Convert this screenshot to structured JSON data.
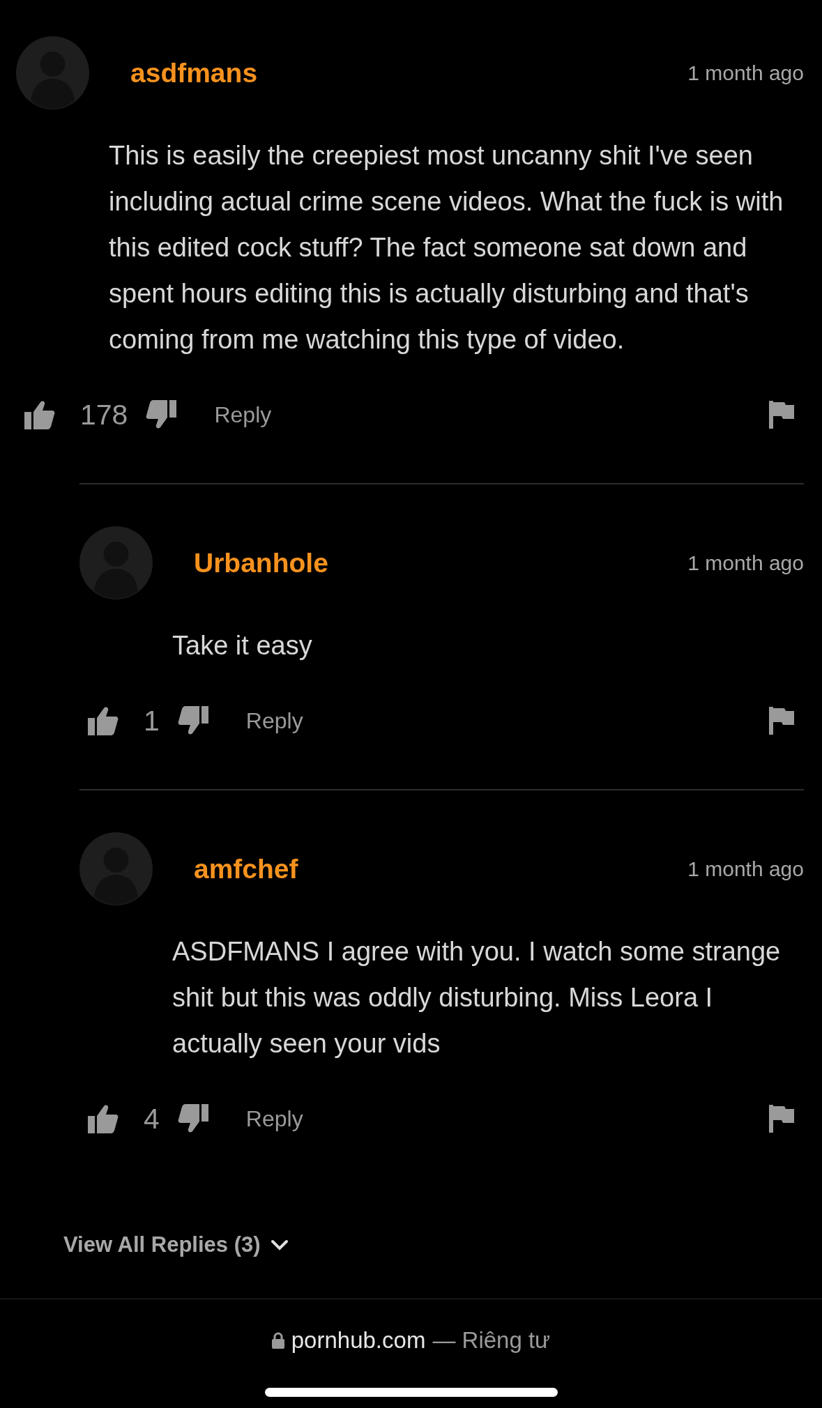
{
  "comments": [
    {
      "username": "asdfmans",
      "time": "1 month ago",
      "body": "This is easily the creepiest most uncanny shit I've seen including actual crime scene videos. What the fuck is with this edited cock stuff? The fact someone sat down and spent hours editing this is actually disturbing and that's coming from me watching this type of video.",
      "likes": "178",
      "reply_label": "Reply",
      "children": [
        {
          "username": "Urbanhole",
          "time": "1 month ago",
          "body": "Take it easy",
          "likes": "1",
          "reply_label": "Reply"
        },
        {
          "username": "amfchef",
          "time": "1 month ago",
          "body": "ASDFMANS I agree with you. I watch some strange shit but this was oddly disturbing. Miss Leora I actually seen your vids",
          "likes": "4",
          "reply_label": "Reply"
        }
      ]
    }
  ],
  "view_all_replies": "View All Replies (3)",
  "browser_bar": {
    "domain": "pornhub.com",
    "privacy": "— Riêng tư"
  }
}
